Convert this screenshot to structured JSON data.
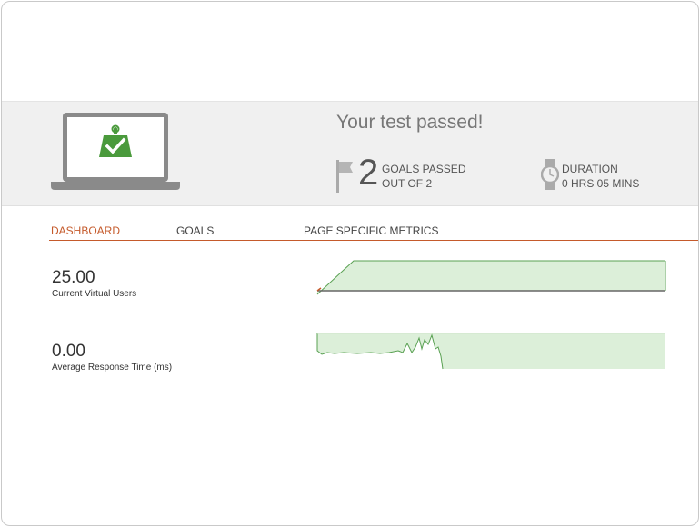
{
  "summary": {
    "headline": "Your test passed!",
    "goals_count": "2",
    "goals_passed_label": "GOALS PASSED",
    "goals_out_of": "OUT OF 2",
    "duration_label": "DURATION",
    "duration_value": "0 HRS  05 MINS"
  },
  "tabs": [
    {
      "label": "DASHBOARD",
      "active": true
    },
    {
      "label": "GOALS",
      "active": false
    },
    {
      "label": "PAGE SPECIFIC METRICS",
      "active": false
    }
  ],
  "metrics": [
    {
      "value": "25.00",
      "label": "Current Virtual Users"
    },
    {
      "value": "0.00",
      "label": "Average Response Time (ms)"
    }
  ],
  "icons": {
    "laptop": "laptop-icon",
    "badge": "weight-check-icon",
    "flag": "flag-icon",
    "watch": "watch-icon"
  },
  "colors": {
    "accent": "#c55a2b",
    "success": "#4a9a3c",
    "chart_fill": "#dcefd9",
    "chart_line": "#5aa153",
    "banner_bg": "#f0f0f0"
  }
}
